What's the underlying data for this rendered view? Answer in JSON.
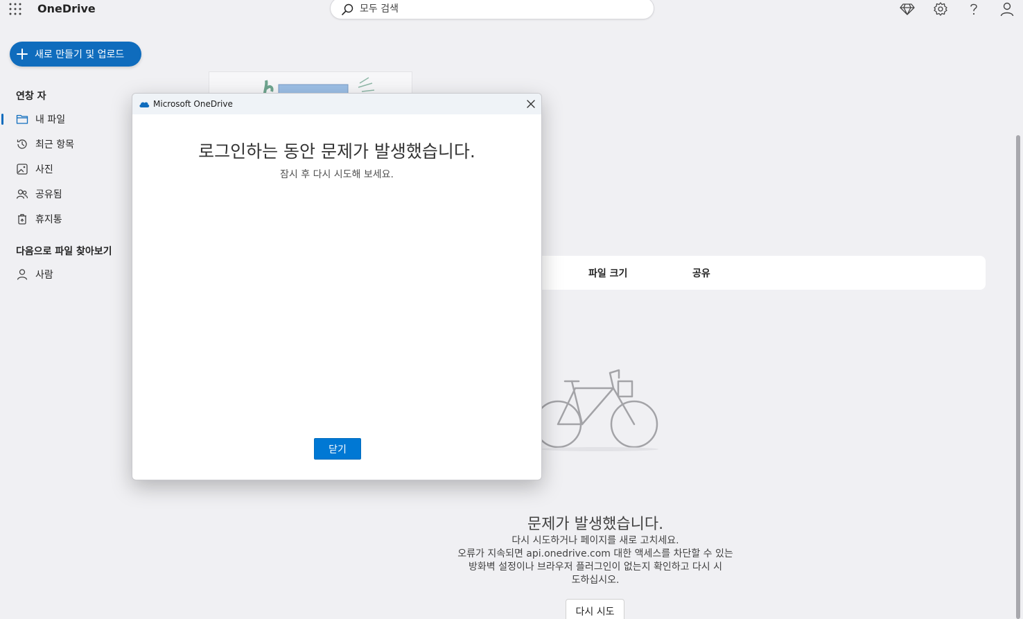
{
  "app": {
    "name": "OneDrive"
  },
  "search": {
    "placeholder": "모두 검색"
  },
  "toolbar": {
    "new_label": "새로 만들기 및 업로드"
  },
  "sidebar": {
    "section_quick": "연창 자",
    "items": [
      {
        "label": "내 파일",
        "icon": "folder-icon"
      },
      {
        "label": "최근 항목",
        "icon": "recent-icon"
      },
      {
        "label": "사진",
        "icon": "photo-icon"
      },
      {
        "label": "공유됨",
        "icon": "shared-icon"
      },
      {
        "label": "휴지통",
        "icon": "recycle-bin-icon"
      }
    ],
    "section_browse": "다음으로 파일 찾아보기",
    "browse_items": [
      {
        "label": "사람",
        "icon": "person-icon"
      }
    ]
  },
  "list": {
    "columns": [
      "파일 크기",
      "공유"
    ]
  },
  "main_error": {
    "title": "문제가 발생했습니다.",
    "line1": "다시 시도하거나 페이지를 새로 고치세요.",
    "line2": "오류가 지속되면 api.onedrive.com 대한 액세스를 차단할 수 있는",
    "line3": "방화벽 설정이나 브라우저 플러그인이 없는지 확인하고 다시 시",
    "line4": "도하십시오.",
    "retry_label": "다시 시도"
  },
  "dialog": {
    "window_title": "Microsoft OneDrive",
    "heading": "로그인하는 동안 문제가 발생했습니다.",
    "subtext": "잠시 후 다시 시도해 보세요.",
    "close_label": "닫기"
  },
  "colors": {
    "accent": "#0f6cbd",
    "dialog_button": "#0078d4",
    "background": "#f0f0f3"
  }
}
